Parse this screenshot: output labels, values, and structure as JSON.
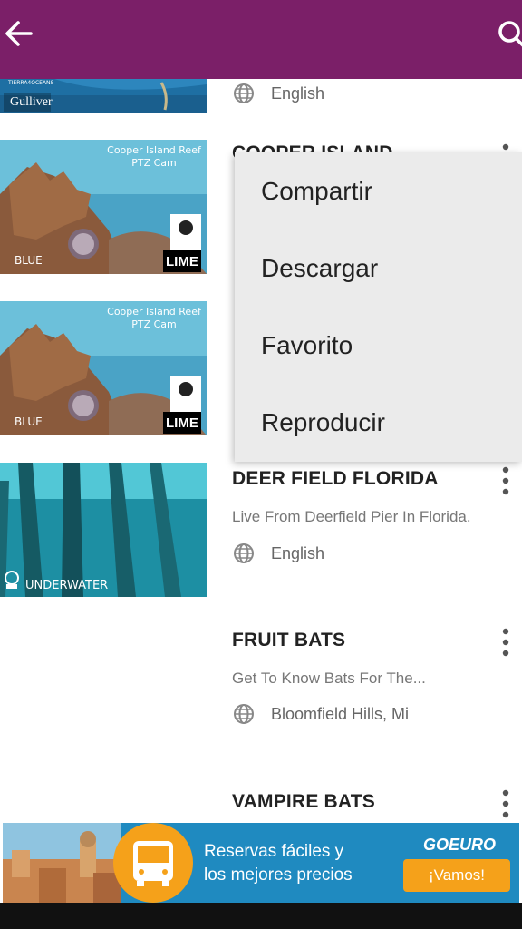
{
  "appbar": {
    "back_icon": "arrow-left-icon",
    "search_icon": "search-icon",
    "background": "#7b1f68"
  },
  "list": [
    {
      "thumb_caption": "Gulliver",
      "thumb_logo": "TIERRA4OCEANS",
      "location": "English"
    },
    {
      "title": "COOPER ISLAND",
      "thumb_overlay": "Cooper Island Reef\nPTZ Cam",
      "thumb_brand": "BLUE",
      "thumb_badge": "LIME"
    },
    {
      "thumb_overlay": "Cooper Island Reef\nPTZ Cam",
      "thumb_brand": "BLUE",
      "thumb_badge": "LIME"
    },
    {
      "title": "DEER FIELD FLORIDA",
      "description": "Live From Deerfield Pier In Florida.",
      "location": "English",
      "thumb_caption": "UNDERWATER"
    },
    {
      "title": "FRUIT BATS",
      "description": "Get To Know Bats For The...",
      "location": "Bloomfield Hills, Mi"
    },
    {
      "title": "VAMPIRE BATS"
    }
  ],
  "popup_menu": [
    "Compartir",
    "Descargar",
    "Favorito",
    "Reproducir"
  ],
  "ad": {
    "line1": "Reservas fáciles y",
    "line2": "los mejores precios",
    "brand": "GOEURO",
    "cta": "¡Vamos!",
    "background": "#1f8ac0",
    "accent": "#f5a11a"
  }
}
